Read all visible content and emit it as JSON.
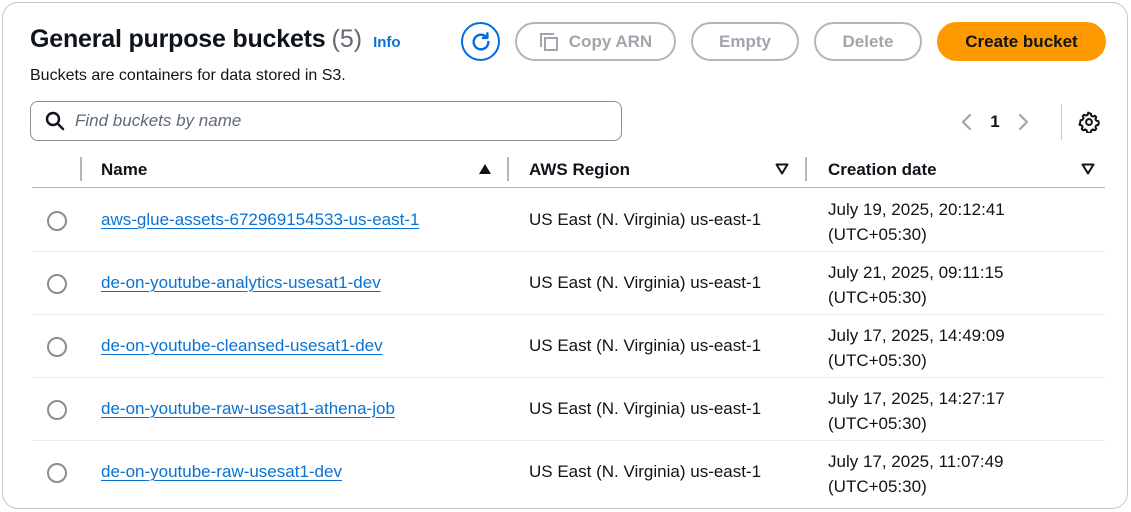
{
  "header": {
    "title": "General purpose buckets",
    "count": "(5)",
    "info_label": "Info",
    "description": "Buckets are containers for data stored in S3."
  },
  "actions": {
    "refresh_icon": "refresh-icon",
    "copy_arn_label": "Copy ARN",
    "copy_icon": "copy-icon",
    "empty_label": "Empty",
    "delete_label": "Delete",
    "create_label": "Create bucket"
  },
  "search": {
    "placeholder": "Find buckets by name",
    "value": "",
    "icon": "search-icon"
  },
  "pagination": {
    "current_page": "1",
    "prev_icon": "chevron-left-icon",
    "next_icon": "chevron-right-icon",
    "settings_icon": "gear-icon"
  },
  "table": {
    "columns": {
      "name": "Name",
      "region": "AWS Region",
      "creation_date": "Creation date"
    },
    "rows": [
      {
        "name": "aws-glue-assets-672969154533-us-east-1",
        "region": "US East (N. Virginia) us-east-1",
        "date": "July 19, 2025, 20:12:41",
        "tz": "(UTC+05:30)"
      },
      {
        "name": "de-on-youtube-analytics-usesat1-dev",
        "region": "US East (N. Virginia) us-east-1",
        "date": "July 21, 2025, 09:11:15",
        "tz": "(UTC+05:30)"
      },
      {
        "name": "de-on-youtube-cleansed-usesat1-dev",
        "region": "US East (N. Virginia) us-east-1",
        "date": "July 17, 2025, 14:49:09",
        "tz": "(UTC+05:30)"
      },
      {
        "name": "de-on-youtube-raw-usesat1-athena-job",
        "region": "US East (N. Virginia) us-east-1",
        "date": "July 17, 2025, 14:27:17",
        "tz": "(UTC+05:30)"
      },
      {
        "name": "de-on-youtube-raw-usesat1-dev",
        "region": "US East (N. Virginia) us-east-1",
        "date": "July 17, 2025, 11:07:49",
        "tz": "(UTC+05:30)"
      }
    ]
  },
  "colors": {
    "accent": "#0972d3",
    "primary_button": "#ff9900",
    "disabled_text": "#a4a4ad"
  }
}
